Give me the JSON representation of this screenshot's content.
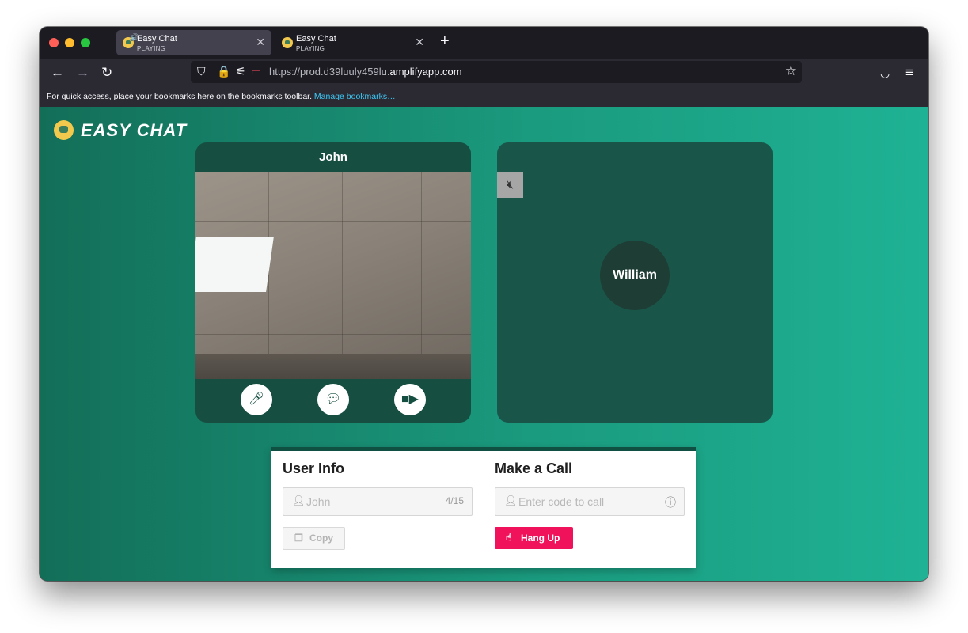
{
  "browser": {
    "tabs": [
      {
        "title": "Easy Chat",
        "subtitle": "PLAYING",
        "active": true
      },
      {
        "title": "Easy Chat",
        "subtitle": "PLAYING",
        "active": false
      }
    ],
    "url_prefix": "https://prod.d39luuly459lu.",
    "url_domain": "amplifyapp.com",
    "bookmarks_text": "For quick access, place your bookmarks here on the bookmarks toolbar.",
    "bookmarks_link": "Manage bookmarks…"
  },
  "app": {
    "logo_text": "EASY CHAT",
    "local_card": {
      "name": "John"
    },
    "remote_card": {
      "name": "William"
    },
    "user_info": {
      "title": "User Info",
      "name_value": "John",
      "char_count": "4/15",
      "copy_label": "Copy"
    },
    "make_call": {
      "title": "Make a Call",
      "placeholder": "Enter code to call",
      "hangup_label": "Hang Up"
    }
  },
  "colors": {
    "accent_red": "#f0125b",
    "card_dark": "#164e41",
    "bg_gradient_start": "#136e58",
    "bg_gradient_end": "#1fb294"
  }
}
